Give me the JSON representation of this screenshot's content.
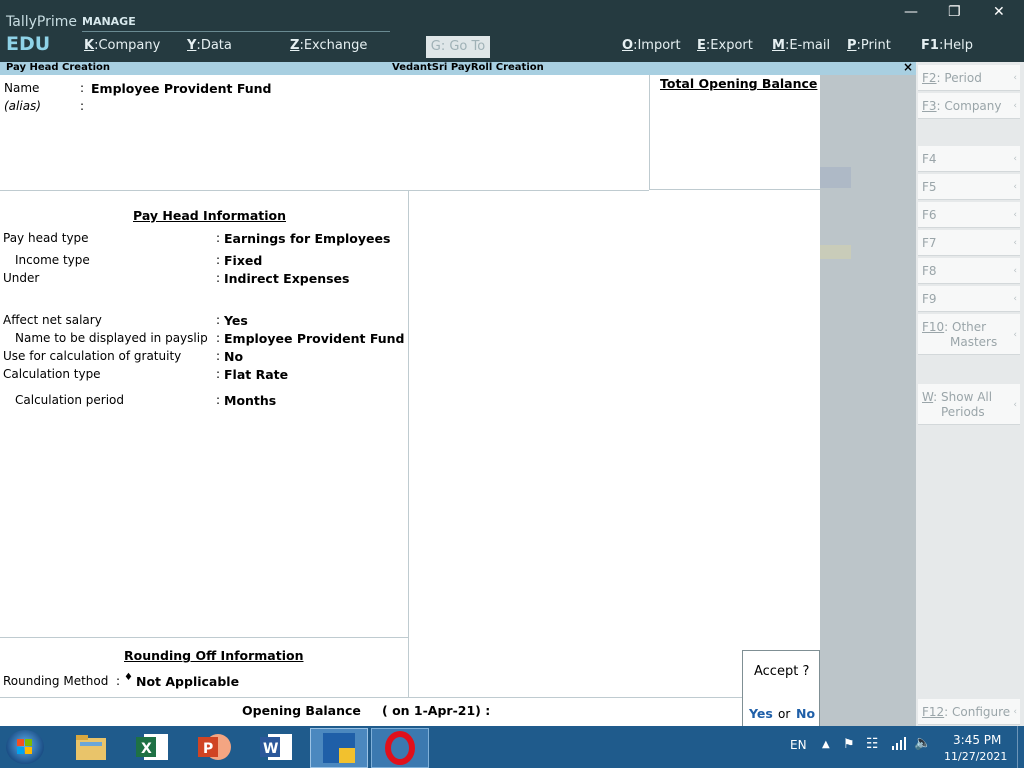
{
  "app": {
    "brand": "TallyPrime",
    "edition": "EDU",
    "manage_label": "MANAGE"
  },
  "menu": [
    {
      "key": "K",
      "label": "Company"
    },
    {
      "key": "Y",
      "label": "Data"
    },
    {
      "key": "Z",
      "label": "Exchange"
    },
    {
      "key": "G",
      "label": "Go To"
    },
    {
      "key": "O",
      "label": "Import"
    },
    {
      "key": "E",
      "label": "Export"
    },
    {
      "key": "M",
      "label": "E-mail"
    },
    {
      "key": "P",
      "label": "Print"
    },
    {
      "key": "F1",
      "label": "Help"
    }
  ],
  "strip": {
    "left_title": "Pay Head  Creation",
    "center_title": "VedantSri PayRoll Creation",
    "close": "×"
  },
  "form": {
    "name_label": "Name",
    "name_value": "Employee Provident Fund",
    "alias_label": "(alias)",
    "total_opening_balance": "Total Opening Balance",
    "section_info": "Pay Head Information",
    "rows": [
      {
        "label": "Pay head type",
        "value": "Earnings for Employees"
      },
      {
        "label": "Income type",
        "value": "Fixed"
      },
      {
        "label": "Under",
        "value": "Indirect Expenses"
      },
      {
        "label": "Affect net salary",
        "value": "Yes"
      },
      {
        "label": "Name to be displayed in payslip",
        "value": "Employee Provident Fund"
      },
      {
        "label": "Use for calculation of gratuity",
        "value": "No"
      },
      {
        "label": "Calculation type",
        "value": "Flat Rate"
      },
      {
        "label": "Calculation period",
        "value": "Months"
      }
    ],
    "section_rounding": "Rounding Off Information",
    "rounding_label": "Rounding Method",
    "rounding_value": "Not Applicable",
    "opening_balance_label": "Opening Balance",
    "opening_balance_date": "( on 1-Apr-21)  :"
  },
  "accept": {
    "question": "Accept ?",
    "yes": "Yes",
    "or": "or",
    "no": "No"
  },
  "sidebar": [
    {
      "key": "F2",
      "label": "Period"
    },
    {
      "key": "F3",
      "label": "Company"
    },
    {
      "key": "F4",
      "label": ""
    },
    {
      "key": "F5",
      "label": ""
    },
    {
      "key": "F6",
      "label": ""
    },
    {
      "key": "F7",
      "label": ""
    },
    {
      "key": "F8",
      "label": ""
    },
    {
      "key": "F9",
      "label": ""
    },
    {
      "key": "F10",
      "label": "Other",
      "label2": "Masters"
    },
    {
      "key": "W",
      "label": "Show All",
      "label2": "Periods"
    },
    {
      "key": "F12",
      "label": "Configure"
    }
  ],
  "taskbar": {
    "lang": "EN",
    "time": "3:45 PM",
    "date": "11/27/2021"
  },
  "colors": {
    "topbar": "#253a40",
    "strip": "#a8cfe1",
    "accent_blue": "#1f5fa8",
    "taskbar": "#1f5b8c"
  }
}
